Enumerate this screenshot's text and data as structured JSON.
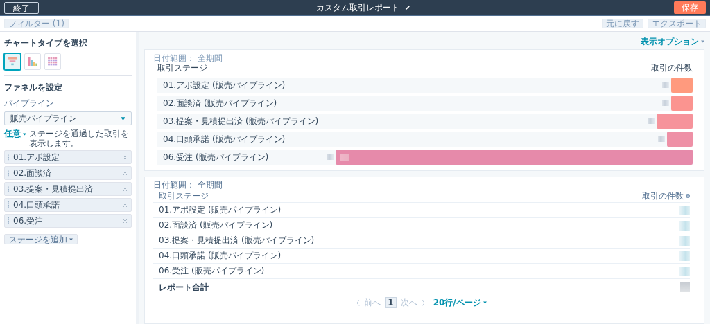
{
  "header": {
    "exit_button": "終了",
    "title": "カスタム取引レポート",
    "save_button": "保存"
  },
  "toolbar": {
    "filter_button": "フィルター (1)",
    "reset_button": "元に戻す",
    "export_button": "エクスポート"
  },
  "sidebar": {
    "chart_type_heading": "チャートタイプを選択",
    "chart_types": [
      {
        "kind": "funnel",
        "selected": true
      },
      {
        "kind": "bar",
        "selected": false
      },
      {
        "kind": "grid",
        "selected": false
      }
    ],
    "funnel_heading": "ファネルを設定",
    "pipeline_label": "パイプライン",
    "pipeline_value": "販売パイプライン",
    "mode_link": "任意",
    "mode_hint": "ステージを通過した取引を表示します。",
    "stages": [
      "01.アポ設定",
      "02.面談済",
      "03.提案・見積提出済",
      "04.口頭承諾",
      "06.受注"
    ],
    "add_stage_button": "ステージを追加"
  },
  "display_options": "表示オプション",
  "funnel_chart": {
    "date_range": "日付範囲： 全期間",
    "stage_header": "取引ステージ",
    "count_header": "取引の件数",
    "rows": [
      {
        "label": "01.アポ設定 (販売パイプライン)",
        "level": 0.04,
        "color": "#ff9a7e"
      },
      {
        "label": "02.面談済 (販売パイプライン)",
        "level": 0.04,
        "color": "#fb9490"
      },
      {
        "label": "03.提案・見積提出済 (販売パイプライン)",
        "level": 0.068,
        "color": "#f6939b"
      },
      {
        "label": "04.口頭承諾 (販売パイプライン)",
        "level": 0.048,
        "color": "#ee90a6"
      },
      {
        "label": "06.受注 (販売パイプライン)",
        "level": 0.667,
        "color": "#e68aaa"
      }
    ]
  },
  "table": {
    "date_range": "日付範囲： 全期間",
    "columns": [
      "取引ステージ",
      "取引の件数"
    ],
    "rows": [
      "01.アポ設定 (販売パイプライン)",
      "02.面談済 (販売パイプライン)",
      "03.提案・見積提出済 (販売パイプライン)",
      "04.口頭承諾 (販売パイプライン)",
      "06.受注 (販売パイプライン)"
    ],
    "total_label": "レポート合計"
  },
  "pagination": {
    "prev": "前へ",
    "page": "1",
    "next": "次へ",
    "page_size": "20行/ページ"
  }
}
